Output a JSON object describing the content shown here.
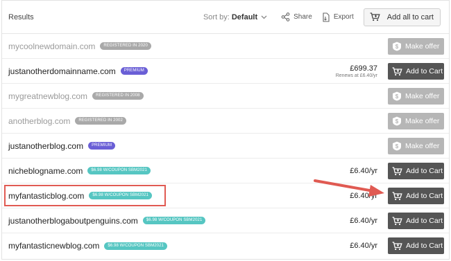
{
  "header": {
    "title": "Results",
    "sort_label": "Sort by:",
    "sort_value": "Default",
    "share_label": "Share",
    "export_label": "Export",
    "add_all_label": "Add all to cart"
  },
  "rows": [
    {
      "domain": "mycoolnewdomain.com",
      "badge": "REGISTERED IN 2020",
      "action": "Make offer"
    },
    {
      "domain": "justanotherdomainname.com",
      "badge": "PREMIUM",
      "price": "£699.37",
      "renew": "Renews at £6.40/yr",
      "action": "Add to Cart"
    },
    {
      "domain": "mygreatnewblog.com",
      "badge": "REGISTERED IN 2008",
      "action": "Make offer"
    },
    {
      "domain": "anotherblog.com",
      "badge": "REGISTERED IN 2002",
      "action": "Make offer"
    },
    {
      "domain": "justanotherblog.com",
      "badge": "PREMIUM",
      "action": "Make offer"
    },
    {
      "domain": "nicheblogname.com",
      "badge": "$6.98 W/COUPON SBM2021",
      "price": "£6.40/yr",
      "action": "Add to Cart"
    },
    {
      "domain": "myfantasticblog.com",
      "badge": "$6.98 W/COUPON SBM2021",
      "price": "£6.40/yr",
      "action": "Add to Cart"
    },
    {
      "domain": "justanotherblogaboutpenguins.com",
      "badge": "$6.98 W/COUPON SBM2021",
      "price": "£6.40/yr",
      "action": "Add to Cart"
    },
    {
      "domain": "myfantasticnewblog.com",
      "badge": "$6.98 W/COUPON SBM2021",
      "price": "£6.40/yr",
      "action": "Add to Cart"
    }
  ],
  "colors": {
    "premium_badge": "#6a5fd6",
    "coupon_badge": "#56c6c2",
    "registered_badge": "#a9a9a9",
    "add_to_cart_button": "#555555",
    "make_offer_button": "#b6b6b6",
    "annotation": "#e05a52"
  },
  "icons": [
    "chevron-down-icon",
    "share-icon",
    "export-icon",
    "cart-icon",
    "dollar-tag-icon",
    "arrow-annotation"
  ]
}
